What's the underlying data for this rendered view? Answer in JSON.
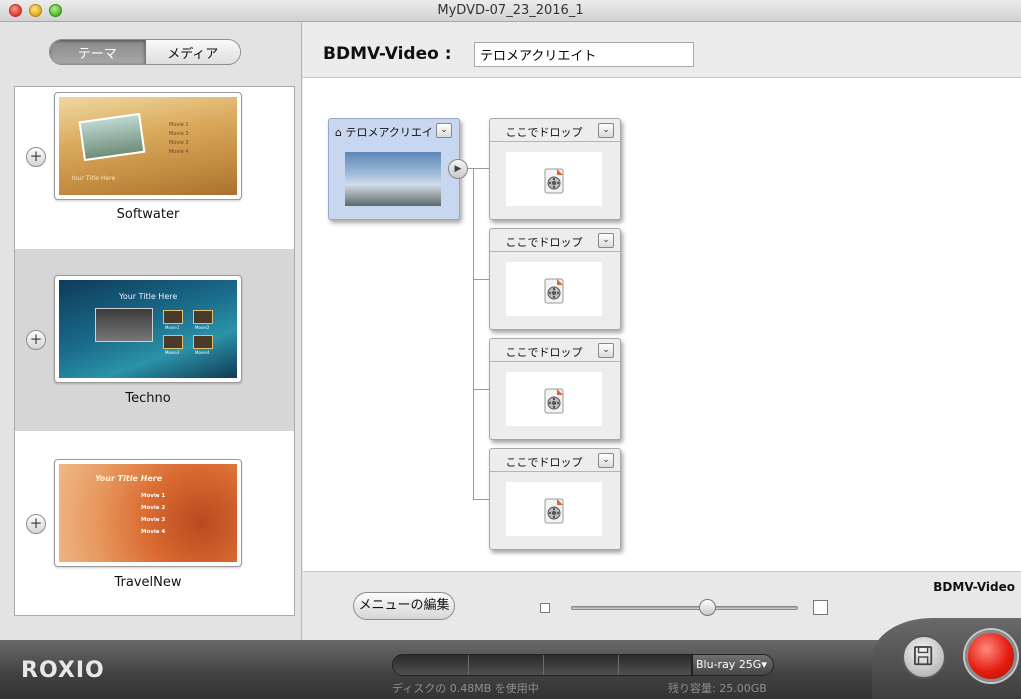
{
  "window": {
    "title": "MyDVD-07_23_2016_1"
  },
  "sidebar": {
    "tabs": [
      {
        "label": "テーマ",
        "active": true
      },
      {
        "label": "メディア",
        "active": false
      }
    ],
    "themes": [
      {
        "name": "Softwater",
        "selected": false,
        "menu": [
          "Movie 1",
          "Movie 2",
          "Movie 3",
          "Movie 4"
        ],
        "title_text": "Your Title Here"
      },
      {
        "name": "Techno",
        "selected": true,
        "title_text": "Your Title Here",
        "menu": [
          "Movie1",
          "Movie2",
          "Movie3",
          "Movie4"
        ]
      },
      {
        "name": "TravelNew",
        "selected": false,
        "title_text": "Your Title Here",
        "menu": [
          "Movie 1",
          "Movie 2",
          "Movie 3",
          "Movie 4"
        ]
      }
    ]
  },
  "header": {
    "label": "BDMV-Video :",
    "title_value": "テロメアクリエイト"
  },
  "canvas": {
    "menu_node": {
      "title": "テロメアクリエイト"
    },
    "drop_nodes": [
      {
        "title": "ここでドロップ"
      },
      {
        "title": "ここでドロップ"
      },
      {
        "title": "ここでドロップ"
      },
      {
        "title": "ここでドロップ"
      }
    ]
  },
  "footer": {
    "format_label": "BDMV-Video",
    "edit_button": "メニューの編集",
    "zoom_level": 0.6
  },
  "bottom": {
    "logo": "ROXIO",
    "disc_type": "Blu-ray 25G▾",
    "used_text": "ディスクの 0.48MB を使用中",
    "remaining_text": "残り容量: 25.00GB",
    "used_fraction": 0.0
  },
  "icons": {
    "plus": "+",
    "dropdown": "⌄",
    "play": "▶",
    "home": "⌂"
  }
}
